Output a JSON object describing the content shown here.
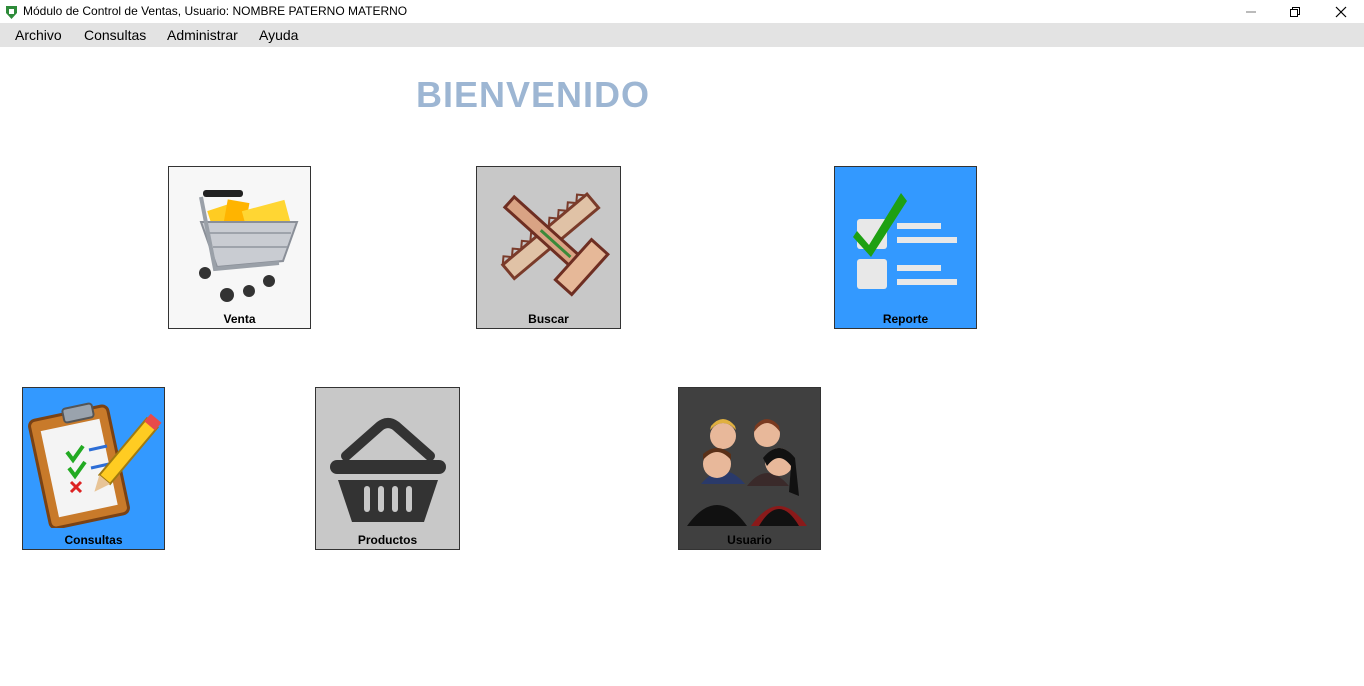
{
  "window": {
    "title": "Módulo de Control de Ventas, Usuario: NOMBRE PATERNO MATERNO",
    "icon": "app-shield-icon",
    "controls": [
      "minimize-icon",
      "restore-icon",
      "close-icon"
    ]
  },
  "menu": {
    "items": [
      {
        "label": "Archivo"
      },
      {
        "label": "Consultas"
      },
      {
        "label": "Administrar"
      },
      {
        "label": "Ayuda"
      }
    ]
  },
  "main": {
    "welcome": "BIENVENIDO",
    "tiles": [
      {
        "label": "Venta",
        "icon": "shopping-cart-icon",
        "background": "#f5f5f5"
      },
      {
        "label": "Buscar",
        "icon": "tools-icon",
        "background": "#c8c8c8"
      },
      {
        "label": "Reporte",
        "icon": "checklist-icon",
        "background": "#3399ff"
      },
      {
        "label": "Consultas",
        "icon": "clipboard-icon",
        "background": "#3399ff"
      },
      {
        "label": "Productos",
        "icon": "basket-icon",
        "background": "#c8c8c8"
      },
      {
        "label": "Usuario",
        "icon": "users-icon",
        "background": "#404040"
      }
    ]
  },
  "colors": {
    "menubar": "#e3e3e3",
    "welcome_text": "#9db6d3",
    "accent_blue": "#3399ff"
  }
}
